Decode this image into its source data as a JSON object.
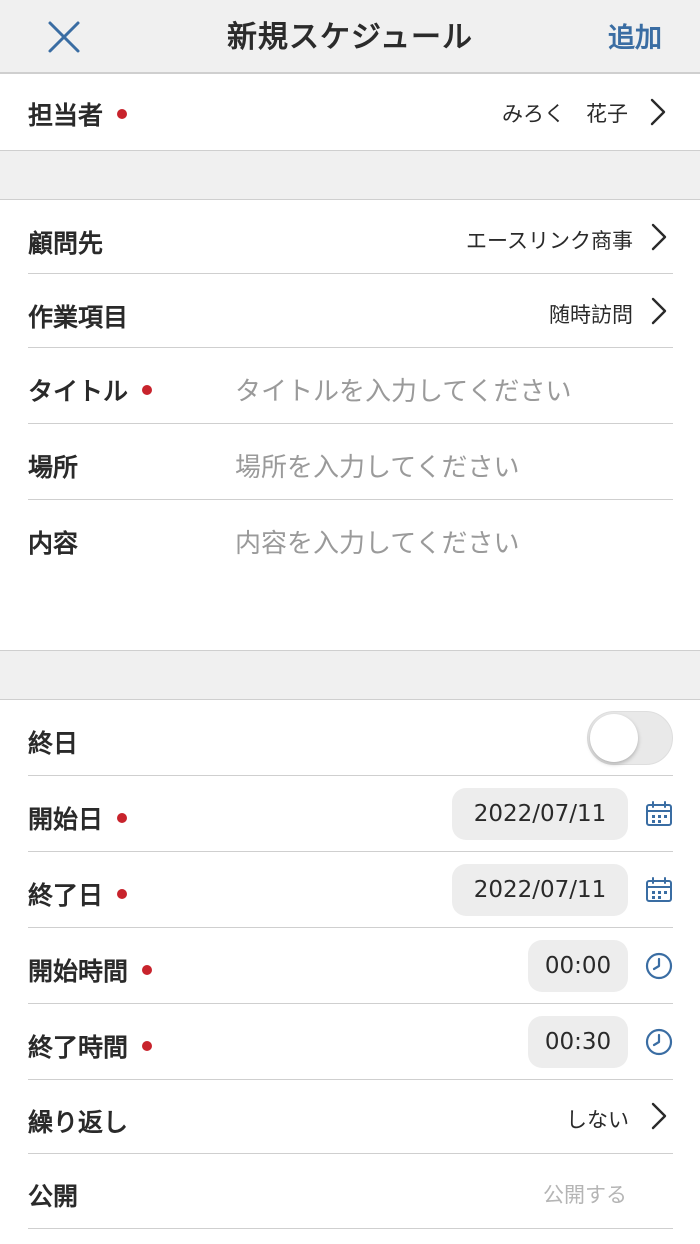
{
  "header": {
    "title": "新規スケジュール",
    "add_label": "追加"
  },
  "assignee": {
    "label": "担当者",
    "value": "みろく　花子"
  },
  "client": {
    "label": "顧問先",
    "value": "エースリンク商事"
  },
  "work_item": {
    "label": "作業項目",
    "value": "随時訪問"
  },
  "title_field": {
    "label": "タイトル",
    "placeholder": "タイトルを入力してください"
  },
  "location": {
    "label": "場所",
    "placeholder": "場所を入力してください"
  },
  "content": {
    "label": "内容",
    "placeholder": "内容を入力してください"
  },
  "all_day": {
    "label": "終日",
    "on": false
  },
  "start_date": {
    "label": "開始日",
    "value": "2022/07/11"
  },
  "end_date": {
    "label": "終了日",
    "value": "2022/07/11"
  },
  "start_time": {
    "label": "開始時間",
    "value": "00:00"
  },
  "end_time": {
    "label": "終了時間",
    "value": "00:30"
  },
  "repeat": {
    "label": "繰り返し",
    "value": "しない"
  },
  "public": {
    "label": "公開",
    "placeholder": "公開する"
  },
  "colors": {
    "accent": "#3a6da3",
    "required": "#c8232c",
    "background_band": "#f0f0f0",
    "placeholder_text": "#9a9a9a"
  }
}
